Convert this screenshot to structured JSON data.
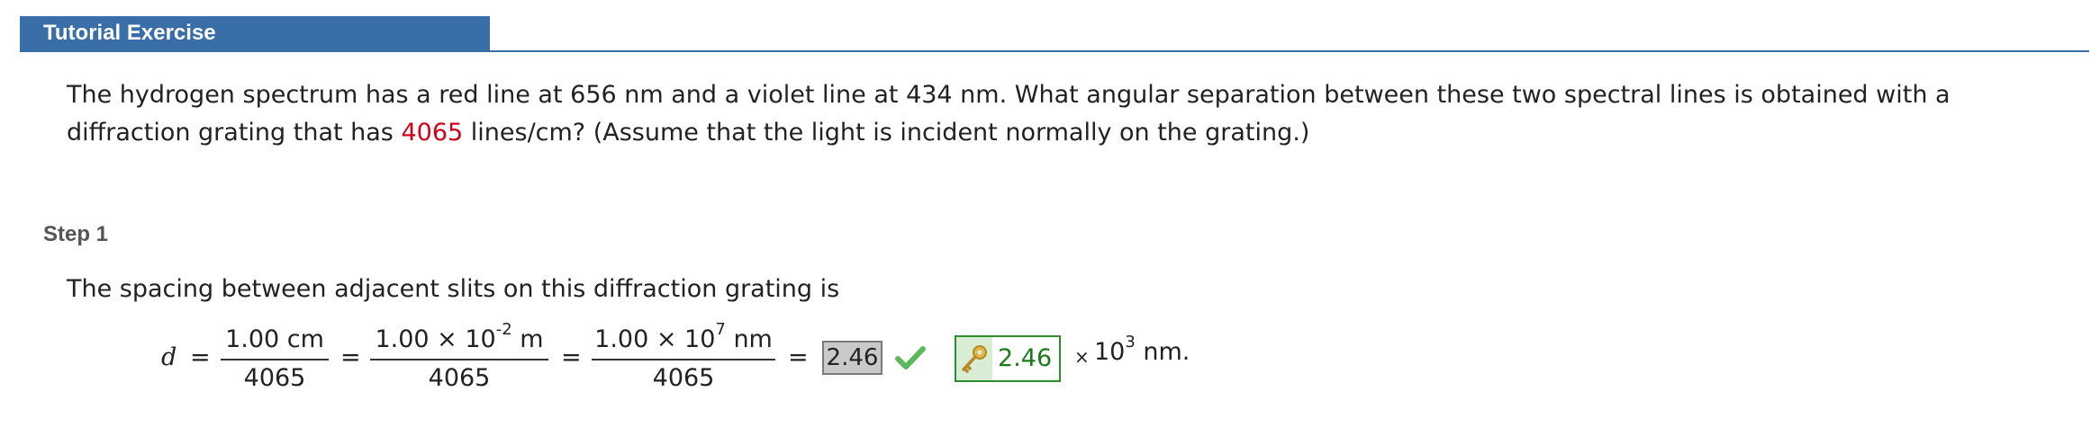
{
  "header": {
    "title": "Tutorial Exercise"
  },
  "problem": {
    "text_before": "The hydrogen spectrum has a red line at 656 nm and a violet line at 434 nm. What angular separation between these two spectral lines is obtained with a diffraction grating that has ",
    "highlight": "4065",
    "text_after": " lines/cm? (Assume that the light is incident normally on the grating.)",
    "highlight_color": "#d0021b"
  },
  "step": {
    "title": "Step 1",
    "explanation": "The spacing between adjacent slits on this diffraction grating is",
    "equation": {
      "variable": "d",
      "equals": "=",
      "frac1": {
        "num": "1.00 cm",
        "den": "4065"
      },
      "frac2": {
        "num_mantissa": "1.00 × 10",
        "num_exp": "-2",
        "num_unit": " m",
        "den": "4065"
      },
      "frac3": {
        "num_mantissa": "1.00 × 10",
        "num_exp": "7",
        "num_unit": " nm",
        "den": "4065"
      },
      "answer_value": "2.46",
      "key_value": "2.46",
      "times": "×",
      "multiplier_base": "10",
      "multiplier_exp": "3",
      "unit": " nm."
    }
  },
  "colors": {
    "header": "#3a6ea8",
    "correct": "#2e8b2e"
  },
  "icons": {
    "check": "check-icon",
    "key": "key-icon"
  }
}
